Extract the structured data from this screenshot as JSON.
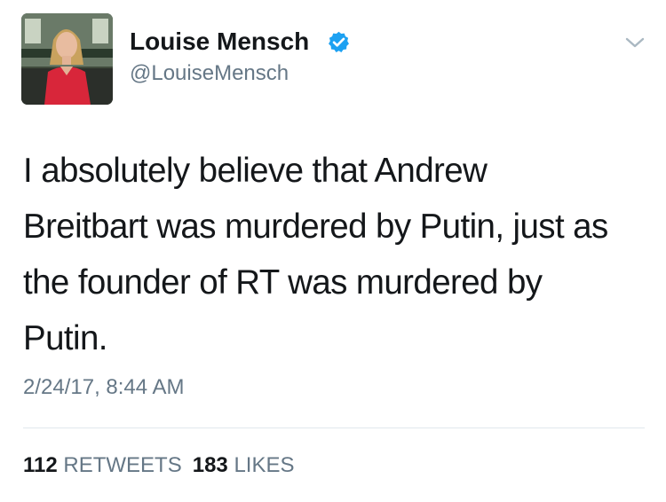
{
  "author": {
    "display_name": "Louise Mensch",
    "handle": "@LouiseMensch",
    "verified": true,
    "avatar_icon": "profile-photo"
  },
  "tweet": {
    "lines": [
      "I absolutely believe that Andrew",
      "Breitbart was murdered by Putin, just as",
      "the founder of RT was murdered by",
      "Putin."
    ],
    "timestamp": "2/24/17, 8:44 AM"
  },
  "stats": {
    "retweets_count": "112",
    "retweets_label": "RETWEETS",
    "likes_count": "183",
    "likes_label": "LIKES"
  },
  "colors": {
    "text_primary": "#14171a",
    "text_secondary": "#657786",
    "verified_blue": "#1da1f2",
    "divider": "#e1e8ed"
  }
}
